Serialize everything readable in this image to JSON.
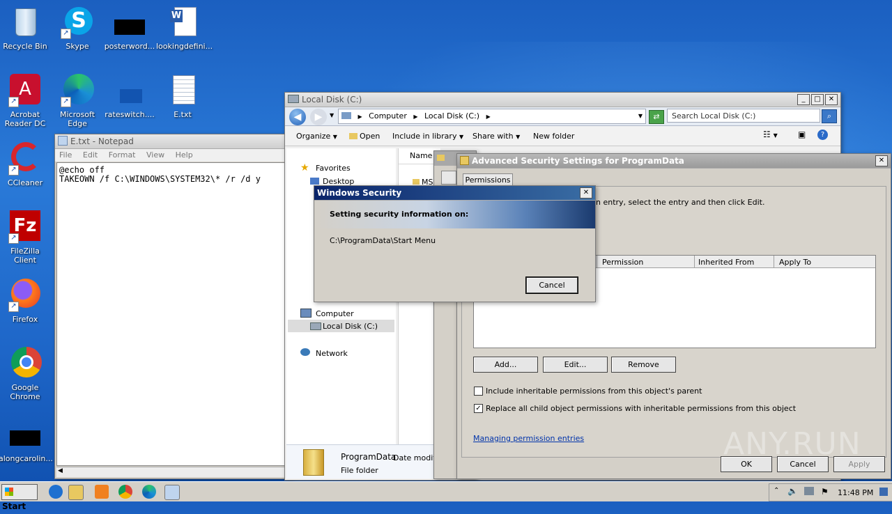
{
  "desktop": {
    "icons": [
      {
        "label": "Recycle Bin"
      },
      {
        "label": "Skype"
      },
      {
        "label": "posterword..."
      },
      {
        "label": "lookingdefini..."
      },
      {
        "label": "Acrobat Reader DC"
      },
      {
        "label": "Microsoft Edge"
      },
      {
        "label": "rateswitch...."
      },
      {
        "label": "E.txt"
      },
      {
        "label": "CCleaner"
      },
      {
        "label": "FileZilla Client"
      },
      {
        "label": "Firefox"
      },
      {
        "label": "Google Chrome"
      },
      {
        "label": "alongcarolin..."
      }
    ]
  },
  "notepad": {
    "title": "E.txt - Notepad",
    "menu": [
      "File",
      "Edit",
      "Format",
      "View",
      "Help"
    ],
    "content": "@echo off\nTAKEOWN /f C:\\WINDOWS\\SYSTEM32\\* /r /d y"
  },
  "explorer": {
    "title": "Local Disk (C:)",
    "breadcrumb": [
      "Computer",
      "Local Disk (C:)"
    ],
    "search_placeholder": "Search Local Disk (C:)",
    "toolbar": [
      "Organize",
      "Open",
      "Include in library",
      "Share with",
      "New folder"
    ],
    "nav": {
      "favorites": "Favorites",
      "desktop": "Desktop",
      "computer": "Computer",
      "local_disk": "Local Disk (C:)",
      "network": "Network"
    },
    "column_name": "Name",
    "list_item_partial": "MS",
    "details": {
      "name": "ProgramData",
      "date_label": "Date modifie",
      "type": "File folder"
    }
  },
  "advanced_security": {
    "title": "Advanced Security Settings for ProgramData",
    "tab": "Permissions",
    "instruction": "n entry, select the entry and then click Edit.",
    "columns": [
      "Permission",
      "Inherited From",
      "Apply To"
    ],
    "buttons": {
      "add": "Add...",
      "edit": "Edit...",
      "remove": "Remove"
    },
    "checkbox1": "Include inheritable permissions from this object's parent",
    "checkbox2": "Replace all child object permissions with inheritable permissions from this object",
    "checkbox1_checked": false,
    "checkbox2_checked": true,
    "link": "Managing permission entries",
    "ok": "OK",
    "cancel": "Cancel",
    "apply": "Apply"
  },
  "windows_security": {
    "title": "Windows Security",
    "heading": "Setting security information on:",
    "path": "C:\\ProgramData\\Start Menu",
    "cancel": "Cancel"
  },
  "watermark": "ANY.RUN",
  "taskbar": {
    "start": "Start",
    "time": "11:48 PM"
  }
}
